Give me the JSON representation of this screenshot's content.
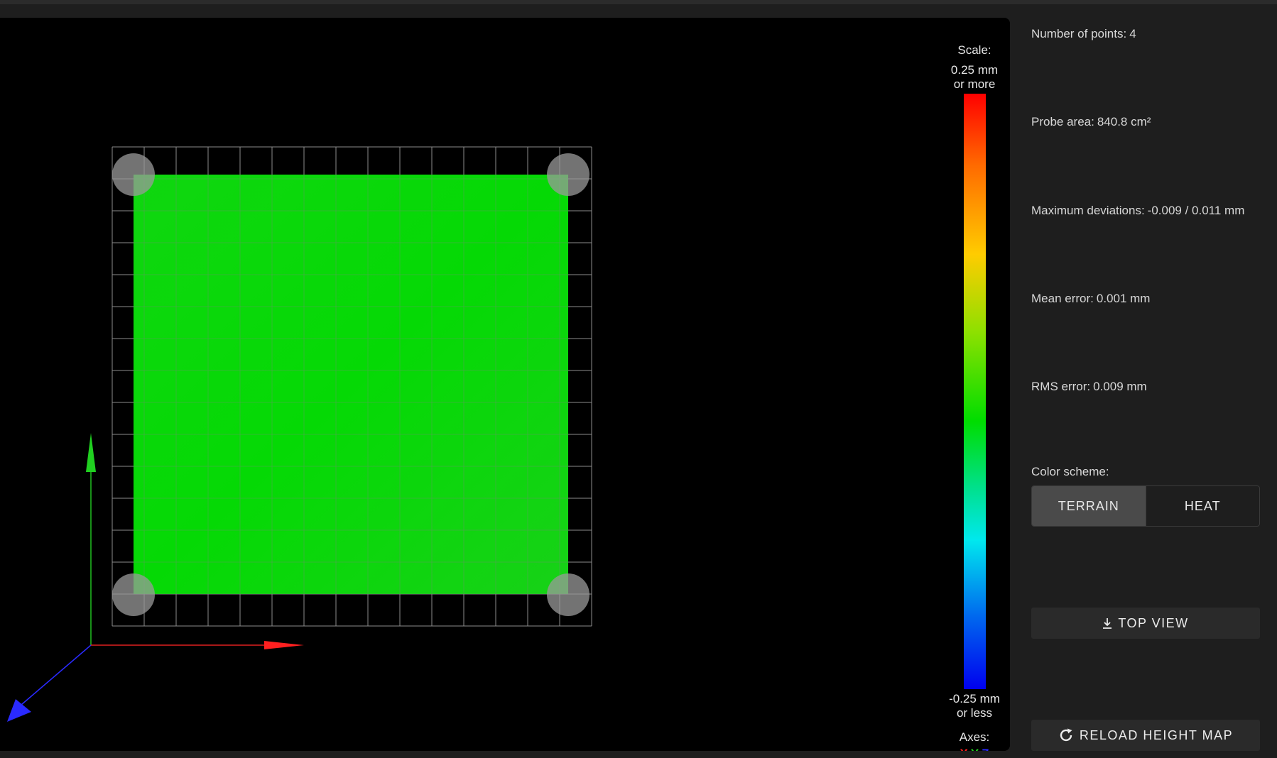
{
  "viewport": {
    "scale": {
      "title": "Scale:",
      "max_label_1": "0.25 mm",
      "max_label_2": "or more",
      "min_label_1": "-0.25 mm",
      "min_label_2": "or less"
    },
    "axes": {
      "title": "Axes:",
      "x": "X",
      "y": "Y",
      "z": "Z"
    },
    "colors": {
      "x_axis": "#ff2020",
      "y_axis": "#20d020",
      "z_axis": "#2a2aff",
      "surface": "#00e000",
      "grid": "#8c8c8c"
    }
  },
  "panel": {
    "stats": [
      {
        "label": "Number of points:",
        "value": "4"
      },
      {
        "label": "Probe area:",
        "value": "840.8 cm²"
      },
      {
        "label": "Maximum deviations:",
        "value": "-0.009 / 0.011 mm"
      },
      {
        "label": "Mean error:",
        "value": "0.001 mm"
      },
      {
        "label": "RMS error:",
        "value": "0.009 mm"
      }
    ],
    "color_scheme": {
      "label": "Color scheme:",
      "options": [
        "TERRAIN",
        "HEAT"
      ],
      "selected": "TERRAIN"
    },
    "top_view": {
      "label": "TOP VIEW",
      "icon": "download-arrow-icon"
    },
    "reload": {
      "label": "RELOAD HEIGHT MAP",
      "icon": "refresh-icon"
    }
  }
}
